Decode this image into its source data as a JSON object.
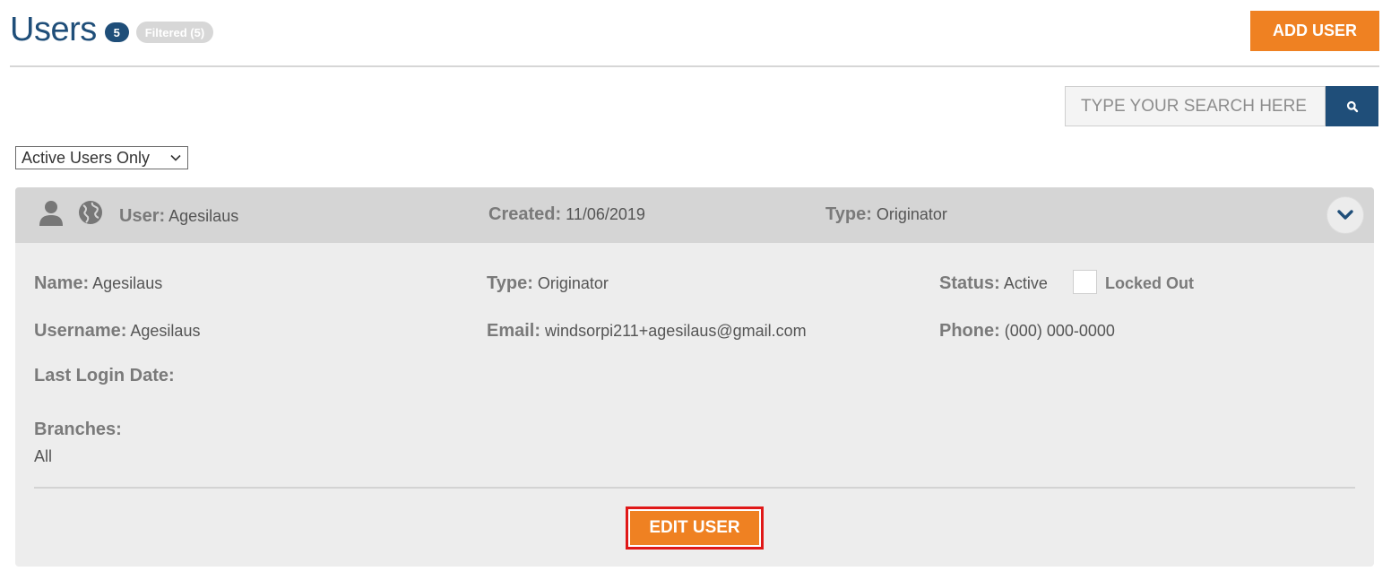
{
  "page": {
    "title": "Users",
    "count_badge": "5",
    "filter_badge": "Filtered (5)",
    "add_user_label": "ADD USER"
  },
  "search": {
    "placeholder": "TYPE YOUR SEARCH HERE",
    "icon": "search-icon"
  },
  "filter": {
    "selected": "Active Users Only"
  },
  "user_card": {
    "header": {
      "user_label": "User:",
      "user_value": "Agesilaus",
      "created_label": "Created:",
      "created_value": "11/06/2019",
      "type_label": "Type:",
      "type_value": "Originator",
      "icons": [
        "user-icon",
        "globe-icon",
        "chevron-down-icon"
      ]
    },
    "details": {
      "name_label": "Name:",
      "name_value": "Agesilaus",
      "type_label": "Type:",
      "type_value": "Originator",
      "status_label": "Status:",
      "status_value": "Active",
      "locked_out_label": "Locked Out",
      "username_label": "Username:",
      "username_value": "Agesilaus",
      "email_label": "Email:",
      "email_value": "windsorpi211+agesilaus@gmail.com",
      "phone_label": "Phone:",
      "phone_value": "(000) 000-0000",
      "last_login_label": "Last Login Date:",
      "branches_label": "Branches:",
      "branches_value": "All"
    },
    "edit_user_label": "EDIT USER"
  },
  "colors": {
    "accent_orange": "#ef8122",
    "brand_navy": "#1f4e79",
    "highlight_red": "#e01818"
  }
}
